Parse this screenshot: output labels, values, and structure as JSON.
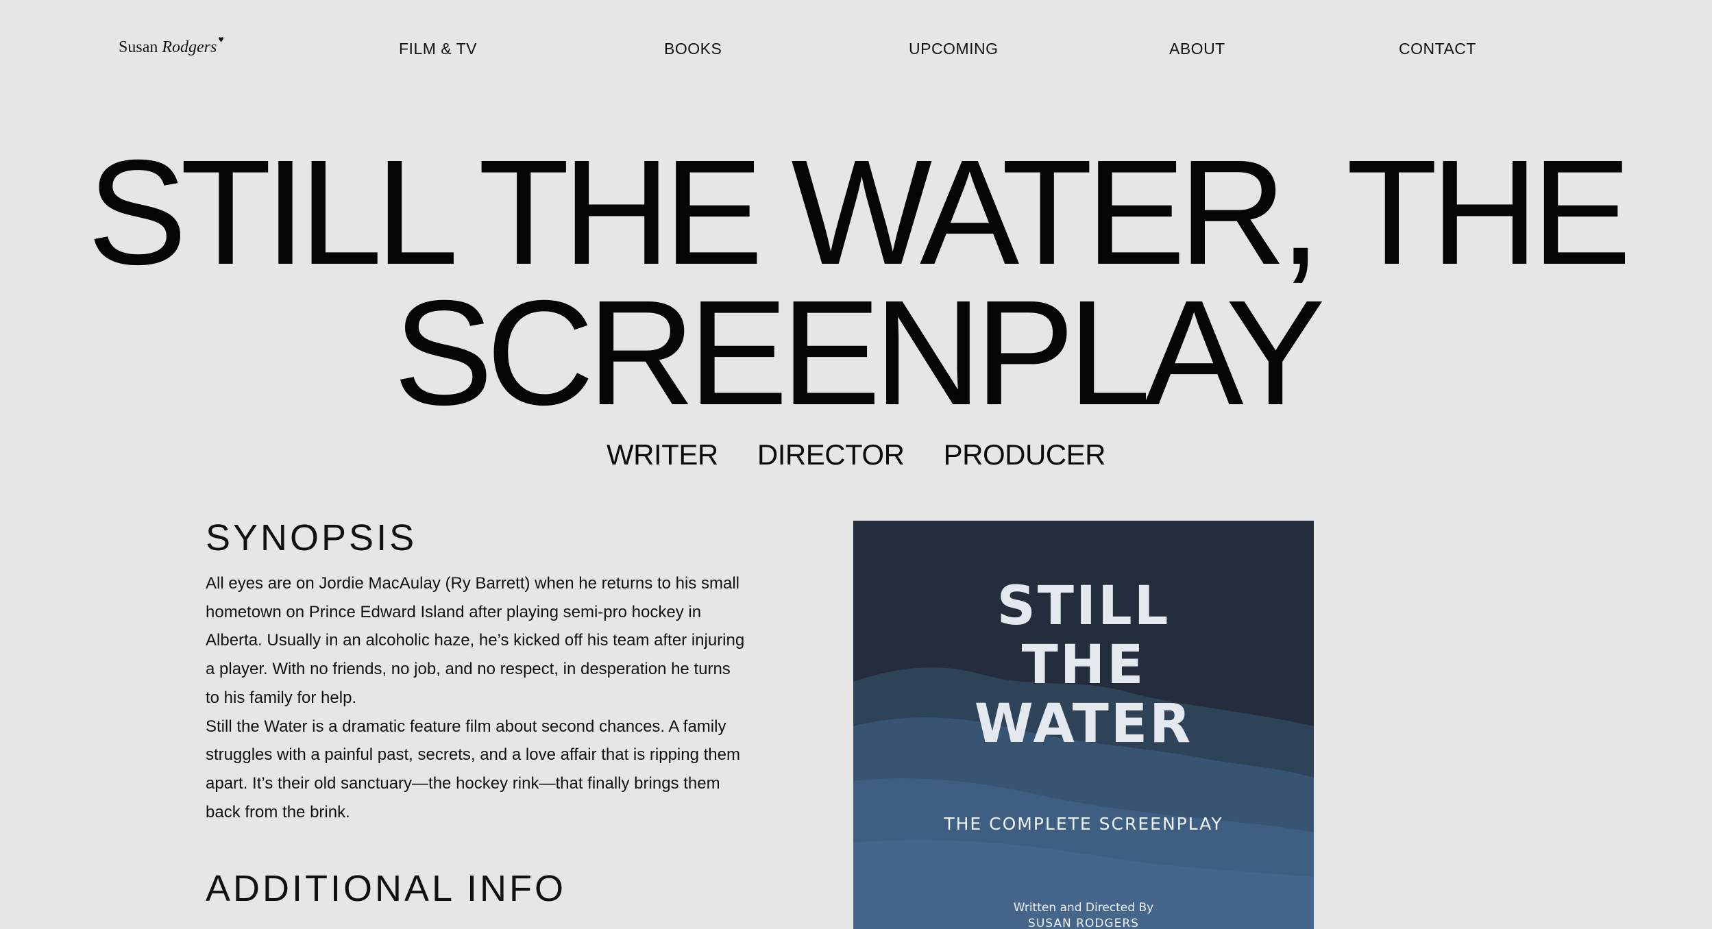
{
  "header": {
    "logo": {
      "first": "Susan",
      "last": "Rodgers",
      "mark": "♥"
    },
    "nav": [
      {
        "label": "FILM & TV"
      },
      {
        "label": "BOOKS"
      },
      {
        "label": "UPCOMING"
      },
      {
        "label": "ABOUT"
      },
      {
        "label": "CONTACT"
      }
    ]
  },
  "hero": {
    "title_line1": "STILL THE WATER, THE",
    "title_line2": "SCREENPLAY",
    "roles": [
      "WRITER",
      "DIRECTOR",
      "PRODUCER"
    ]
  },
  "synopsis": {
    "heading": "SYNOPSIS",
    "paragraphs": [
      "All eyes are on Jordie MacAulay (Ry Barrett) when he returns to his small hometown on Prince Edward Island after playing semi-pro hockey in Alberta. Usually in an alcoholic haze, he’s kicked off his team after injuring a player. With no friends, no job, and no respect, in desperation he turns to his family for help.",
      "Still the Water is a dramatic feature film about second chances. A family struggles with a painful past, secrets, and a love affair that is ripping them apart.  It’s their old sanctuary—the hockey rink—that finally brings them back from the brink."
    ]
  },
  "additional_info": {
    "heading": "ADDITIONAL INFO"
  },
  "cover": {
    "title_lines": [
      "STILL",
      "THE",
      "WATER"
    ],
    "subtitle": "THE COMPLETE SCREENPLAY",
    "credit_line": "Written and Directed By",
    "credit_name": "SUSAN RODGERS",
    "colors": {
      "background": "#232d3b",
      "wave_dark": "#2e4258",
      "wave_mid": "#385473",
      "wave_light": "#3f5f82",
      "text": "#e4e9f0"
    }
  }
}
